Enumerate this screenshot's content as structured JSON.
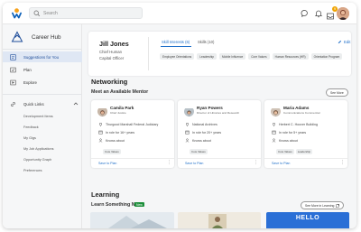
{
  "topbar": {
    "search_placeholder": "Search",
    "icons": [
      "workday-logo",
      "search-icon",
      "chat-icon",
      "bell-icon",
      "inbox-icon",
      "avatar"
    ],
    "inbox_badge": "9"
  },
  "sidebar": {
    "hub_title": "Career Hub",
    "items": [
      {
        "label": "Suggestions for You",
        "icon": "lightbulb-icon",
        "active": true
      },
      {
        "label": "Plan",
        "icon": "target-icon",
        "active": false
      },
      {
        "label": "Explore",
        "icon": "compass-icon",
        "active": false
      }
    ],
    "quick_links_label": "Quick Links",
    "quick_links": [
      "Development Items",
      "Feedback",
      "My Gigs",
      "My Job Applications",
      "Opportunity Graph",
      "Preferences"
    ]
  },
  "profile": {
    "name": "Jill Jones",
    "title": "Chief Human",
    "subtitle": "Capital Officer",
    "tabs": [
      {
        "label": "Skill Interests (6)",
        "active": true
      },
      {
        "label": "Skills (10)",
        "active": false
      }
    ],
    "chips": [
      "Employee Orientations",
      "Leadership",
      "Mobile Influence",
      "Core Values",
      "Human Resources (HR)",
      "Orientation Program"
    ],
    "edit_label": "Edit"
  },
  "networking": {
    "heading": "Networking",
    "subheading": "Meet an Available Mentor",
    "see_more": "See More",
    "mentors": [
      {
        "name": "Camila Park",
        "role": "Chief Justice",
        "location": "Thurgood Marshall Federal Judiciary",
        "tenure": "In role for 16+ years",
        "known_about": "Knows about",
        "chips": [
          "Core Values"
        ],
        "save": "Save to Plan"
      },
      {
        "name": "Ryan Powers",
        "role": "Director of Libraries and Research",
        "location": "National Archives",
        "tenure": "In role for 20+ years",
        "known_about": "Knows about",
        "chips": [
          "Core Values"
        ],
        "save": "Save to Plan"
      },
      {
        "name": "Maria Adams",
        "role": "Communications Commercial",
        "location": "Herbert C. Hoover Building",
        "tenure": "In role for 5+ years",
        "known_about": "Knows about",
        "chips": [
          "Core Values",
          "Leadership"
        ],
        "save": "Save to Plan"
      }
    ]
  },
  "learning": {
    "heading": "Learning",
    "subheading": "Learn Something New",
    "new_badge": "New",
    "see_more": "See More in Learning",
    "thumb_text": "HELLO"
  },
  "colors": {
    "accent": "#1f6fc9",
    "active_bg": "#dfe7f4",
    "new_badge": "#1c8f3a"
  }
}
